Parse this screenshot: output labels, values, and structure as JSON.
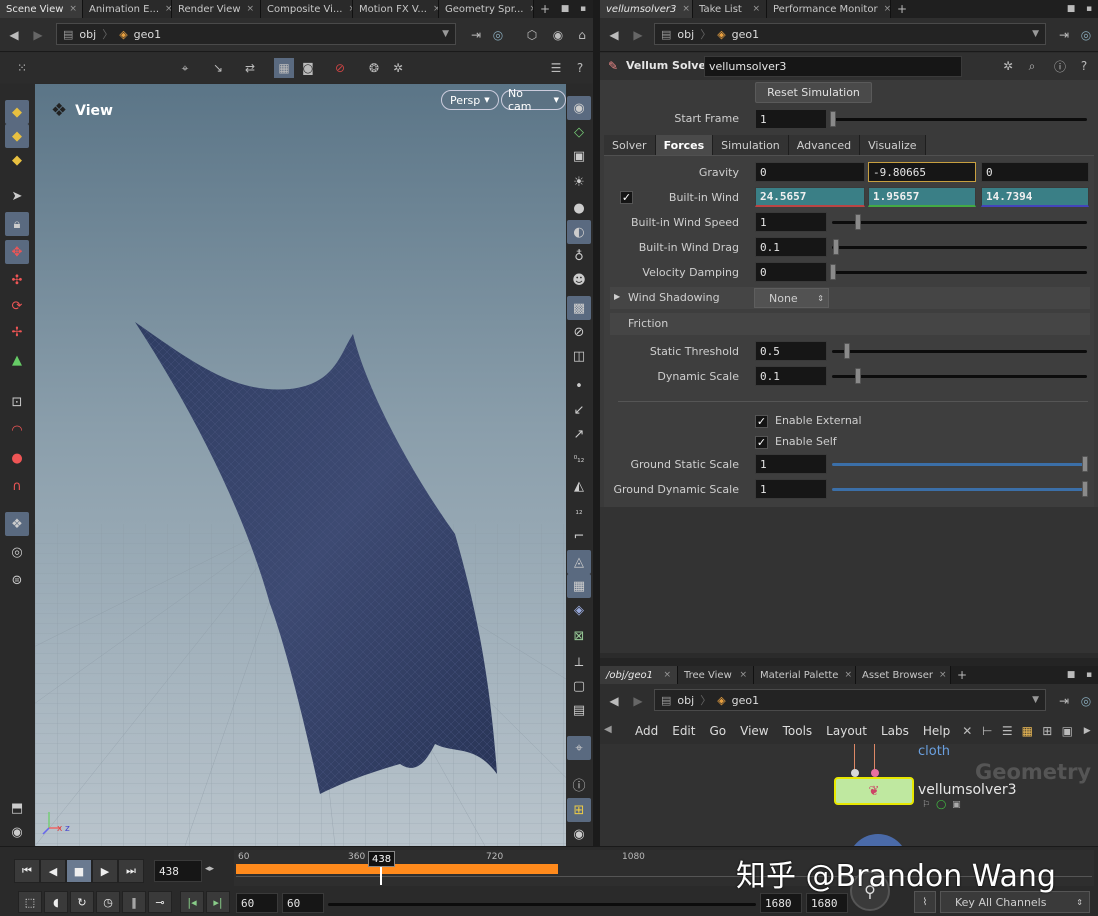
{
  "left_tabs": [
    {
      "label": "Scene View",
      "active": true
    },
    {
      "label": "Animation E...",
      "active": false
    },
    {
      "label": "Render View",
      "active": false
    },
    {
      "label": "Composite Vi...",
      "active": false
    },
    {
      "label": "Motion FX V...",
      "active": false
    },
    {
      "label": "Geometry Spr...",
      "active": false
    }
  ],
  "right_tabs": [
    {
      "label": "vellumsolver3",
      "active": true
    },
    {
      "label": "Take List",
      "active": false
    },
    {
      "label": "Performance Monitor",
      "active": false
    }
  ],
  "left_path": {
    "root": "obj",
    "node": "geo1"
  },
  "right_path": {
    "root": "obj",
    "node": "geo1"
  },
  "viewport": {
    "title": "View",
    "camera_mode": "Persp",
    "camera": "No cam",
    "axis_label_x": "x",
    "axis_label_z": "z"
  },
  "param_header": {
    "type": "Vellum Solver",
    "name": "vellumsolver3"
  },
  "reset_button": "Reset Simulation",
  "start_frame": {
    "label": "Start Frame",
    "value": "1"
  },
  "param_tabs": [
    {
      "label": "Solver",
      "active": false
    },
    {
      "label": "Forces",
      "active": true
    },
    {
      "label": "Simulation",
      "active": false
    },
    {
      "label": "Advanced",
      "active": false
    },
    {
      "label": "Visualize",
      "active": false
    }
  ],
  "gravity": {
    "label": "Gravity",
    "x": "0",
    "y": "-9.80665",
    "z": "0"
  },
  "builtin_wind": {
    "label": "Built-in Wind",
    "x": "24.5657",
    "y": "1.95657",
    "z": "14.7394",
    "checked": true
  },
  "wind_speed": {
    "label": "Built-in Wind Speed",
    "value": "1"
  },
  "wind_drag": {
    "label": "Built-in Wind Drag",
    "value": "0.1"
  },
  "velocity_damping": {
    "label": "Velocity Damping",
    "value": "0"
  },
  "wind_shadowing": {
    "label": "Wind Shadowing",
    "value": "None"
  },
  "friction": {
    "heading": "Friction"
  },
  "static_threshold": {
    "label": "Static Threshold",
    "value": "0.5"
  },
  "dynamic_scale": {
    "label": "Dynamic Scale",
    "value": "0.1"
  },
  "enable_external": {
    "label": "Enable External",
    "checked": true
  },
  "enable_self": {
    "label": "Enable Self",
    "checked": true
  },
  "ground_static": {
    "label": "Ground Static Scale",
    "value": "1"
  },
  "ground_dynamic": {
    "label": "Ground Dynamic Scale",
    "value": "1"
  },
  "network_tabs": [
    {
      "label": "/obj/geo1",
      "active": true
    },
    {
      "label": "Tree View",
      "active": false
    },
    {
      "label": "Material Palette",
      "active": false
    },
    {
      "label": "Asset Browser",
      "active": false
    }
  ],
  "network_path": {
    "root": "obj",
    "node": "geo1"
  },
  "network_menu": [
    "Add",
    "Edit",
    "Go",
    "View",
    "Tools",
    "Layout",
    "Labs",
    "Help"
  ],
  "network": {
    "context_label": "Geometry",
    "upstream_node": "cloth",
    "node_name": "vellumsolver3"
  },
  "timeline": {
    "current_frame": "438",
    "marker": "438",
    "ticks": [
      "60",
      "360",
      "720",
      "1080"
    ],
    "start": "60",
    "range_start": "60",
    "range_end": "1680",
    "end": "1680",
    "key_channels": "Key All Channels",
    "watermark": "知乎 @Brandon Wang"
  },
  "colors": {
    "accent_orange": "#ff8a1c",
    "wind_teal": "#3a7f86",
    "node_green": "#bfe8a0",
    "selection_yellow": "#e8e800"
  }
}
